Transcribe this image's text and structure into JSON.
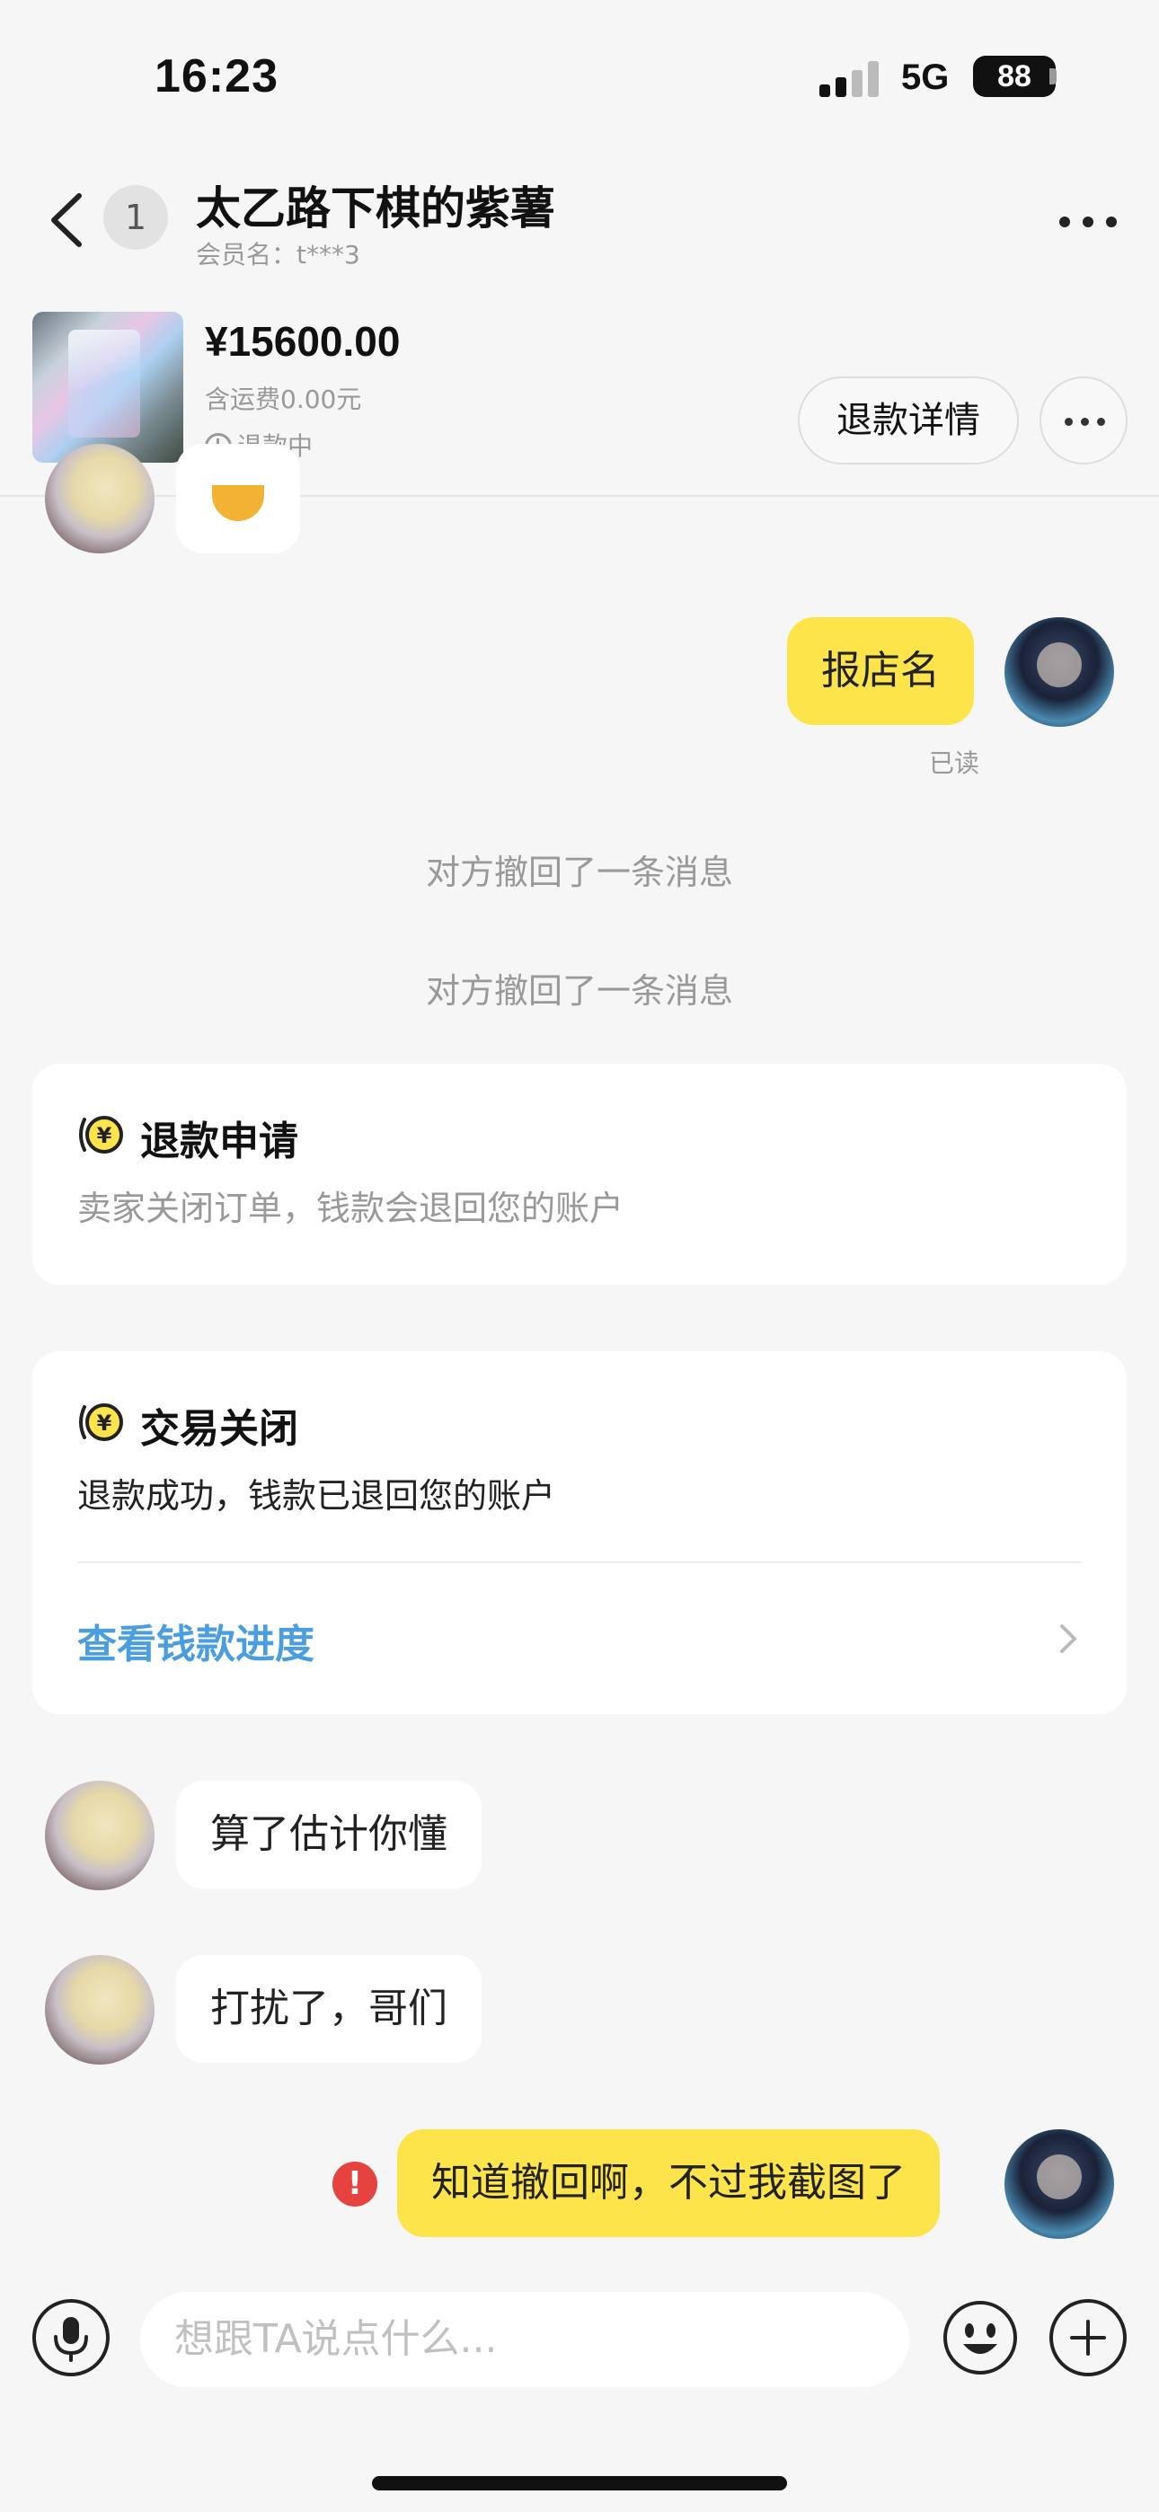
{
  "status_bar": {
    "time": "16:23",
    "network": "5G",
    "battery": "88"
  },
  "header": {
    "unread_count": "1",
    "title": "太乙路下棋的紫薯",
    "member_label": "会员名：t***3"
  },
  "product": {
    "price": "¥15600.00",
    "shipping": "含运费0.00元",
    "status": "退款中",
    "refund_details_button": "退款详情"
  },
  "messages": {
    "out_1": "报店名",
    "read_receipt": "已读",
    "system_1": "对方撤回了一条消息",
    "system_2": "对方撤回了一条消息",
    "in_1": "算了估计你懂",
    "in_2": "打扰了，哥们",
    "out_2": "知道撤回啊，不过我截图了",
    "out_2_error": "!"
  },
  "cards": {
    "refund_apply": {
      "title": "退款申请",
      "desc": "卖家关闭订单，钱款会退回您的账户"
    },
    "trade_closed": {
      "title": "交易关闭",
      "desc": "退款成功，钱款已退回您的账户",
      "link": "查看钱款进度"
    }
  },
  "input": {
    "placeholder": "想跟TA说点什么..."
  },
  "icons": {
    "back": "chevron-left-icon",
    "more": "more-icon",
    "clock": "clock-icon",
    "yen": "yen-icon",
    "mic": "microphone-icon",
    "emoji": "emoji-icon",
    "plus": "plus-icon",
    "error": "error-icon"
  },
  "colors": {
    "accent_yellow": "#fde44b",
    "link_blue": "#4a9ee0",
    "error_red": "#e64340"
  }
}
